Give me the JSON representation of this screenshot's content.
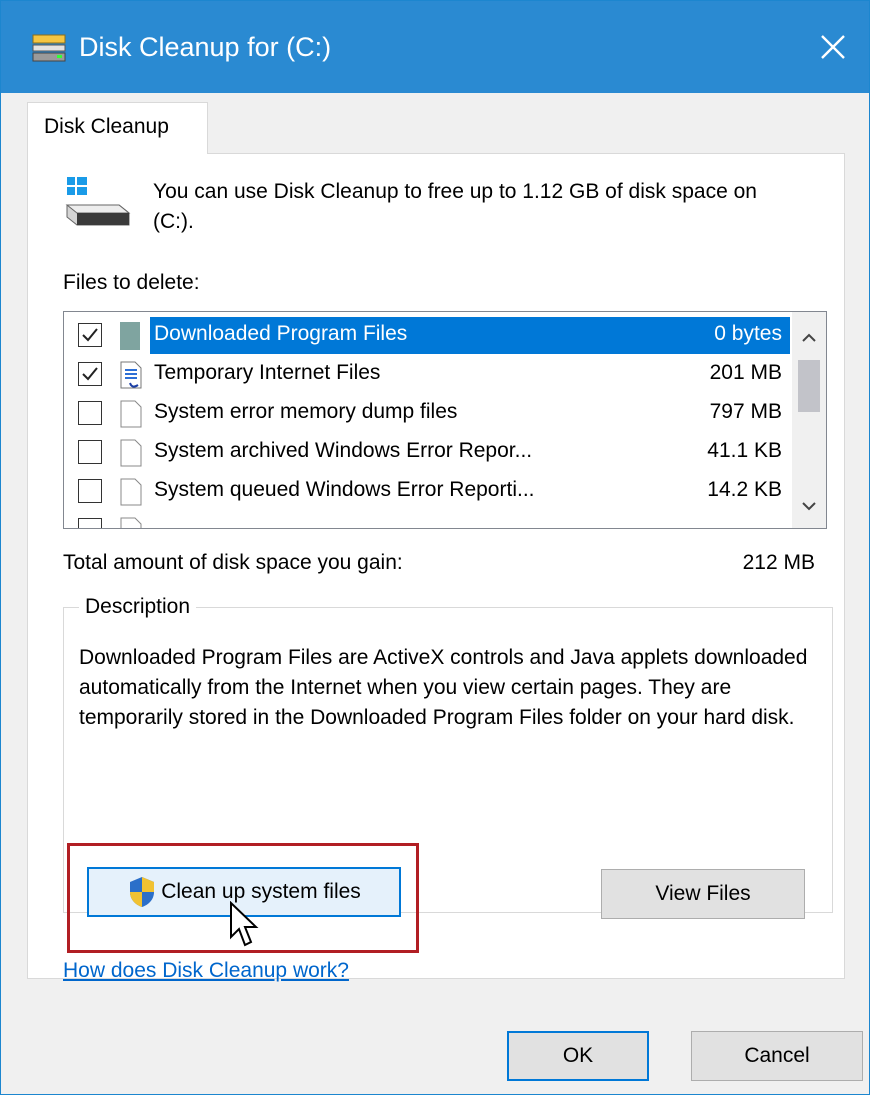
{
  "window": {
    "title": "Disk Cleanup for  (C:)",
    "close_icon": "close-icon",
    "title_icon": "disk-cleanup-icon"
  },
  "tabs": [
    {
      "label": "Disk Cleanup",
      "selected": true
    }
  ],
  "intro": {
    "icon": "windows-drive-icon",
    "text": "You can use Disk Cleanup to free up to 1.12 GB of disk space on  (C:)."
  },
  "files": {
    "label": "Files to delete:",
    "items": [
      {
        "name": "Downloaded Program Files",
        "size": "0 bytes",
        "checked": true,
        "selected": true,
        "icon": "folder-icon"
      },
      {
        "name": "Temporary Internet Files",
        "size": "201 MB",
        "checked": true,
        "selected": false,
        "icon": "document-icon"
      },
      {
        "name": "System error memory dump files",
        "size": "797 MB",
        "checked": false,
        "selected": false,
        "icon": "blank-file-icon"
      },
      {
        "name": "System archived Windows Error Repor...",
        "size": "41.1 KB",
        "checked": false,
        "selected": false,
        "icon": "blank-file-icon"
      },
      {
        "name": "System queued Windows Error Reporti...",
        "size": "14.2 KB",
        "checked": false,
        "selected": false,
        "icon": "blank-file-icon"
      }
    ]
  },
  "total": {
    "label": "Total amount of disk space you gain:",
    "value": "212 MB"
  },
  "description": {
    "legend": "Description",
    "text": "Downloaded Program Files are ActiveX controls and Java applets downloaded automatically from the Internet when you view certain pages. They are temporarily stored in the Downloaded Program Files folder on your hard disk."
  },
  "buttons": {
    "cleanup_system": "Clean up system files",
    "view_files": "View Files",
    "ok": "OK",
    "cancel": "Cancel"
  },
  "link": {
    "text": "How does Disk Cleanup work?"
  },
  "colors": {
    "titlebar": "#2a8ad2",
    "selection": "#0078d7",
    "highlight_box": "#b11e23",
    "link": "#0066cc"
  }
}
